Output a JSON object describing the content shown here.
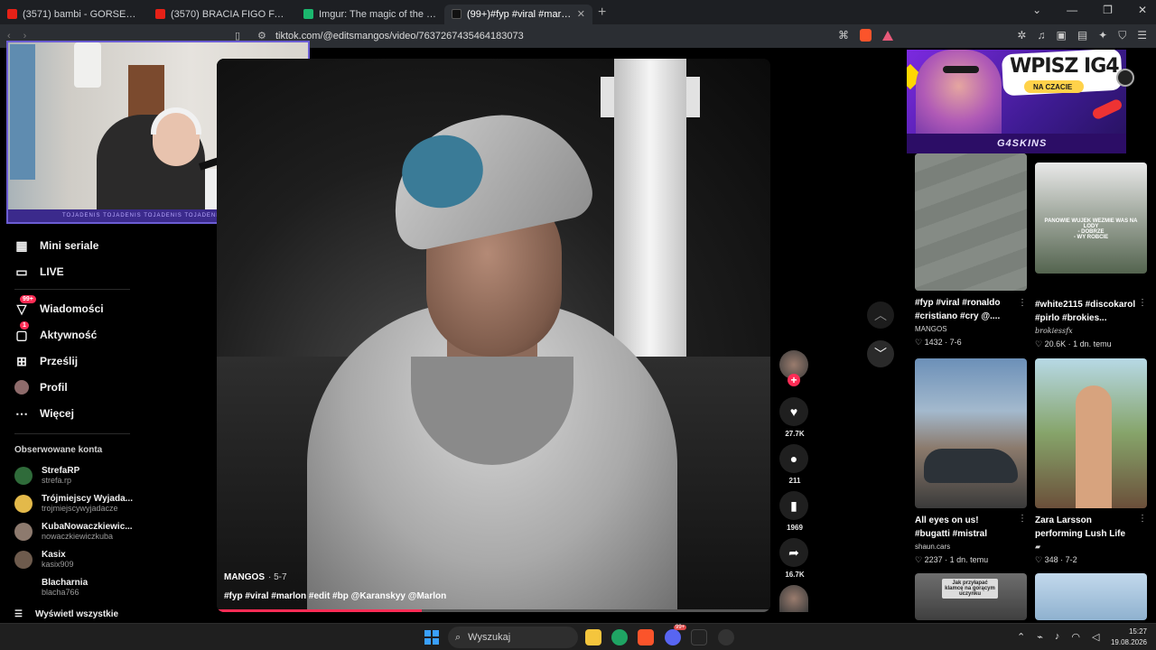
{
  "browser": {
    "tabs": [
      {
        "title": "(3571) bambi - GORSET - YouTube",
        "icon": "youtube-icon"
      },
      {
        "title": "(3570) BRACIA FIGO FAGOT - CZY KO",
        "icon": "youtube-icon"
      },
      {
        "title": "Imgur: The magic of the Internet",
        "icon": "imgur-icon"
      },
      {
        "title": "(99+)#fyp #viral #marlon #edit #",
        "icon": "tiktok-icon"
      }
    ],
    "url": "tiktok.com/@editsmangos/video/7637267435464183073"
  },
  "webcam": {
    "strip_text": "TOJADENIS TOJADENIS TOJADENIS TOJADENIS TOJADENIS TOJADENIS TOJADENIS"
  },
  "sidebar": {
    "nav": [
      {
        "label": "Mini seriale",
        "icon": "mini-series-icon"
      },
      {
        "label": "LIVE",
        "icon": "live-icon"
      },
      {
        "label": "Wiadomości",
        "icon": "messages-icon",
        "badge": "99+"
      },
      {
        "label": "Aktywność",
        "icon": "activity-icon",
        "badge": "1"
      },
      {
        "label": "Prześlij",
        "icon": "upload-icon"
      },
      {
        "label": "Profil",
        "icon": "profile-icon"
      },
      {
        "label": "Więcej",
        "icon": "more-icon"
      }
    ],
    "following_title": "Obserwowane konta",
    "following": [
      {
        "name": "StrefaRP",
        "handle": "strefa.rp"
      },
      {
        "name": "Trójmiejscy Wyjada...",
        "handle": "trojmiejscywyjadacze"
      },
      {
        "name": "KubaNowaczkiewic...",
        "handle": "nowaczkiewiczkuba"
      },
      {
        "name": "Kasix",
        "handle": "kasix909"
      },
      {
        "name": "Blacharnia",
        "handle": "blacha766"
      }
    ],
    "see_all": "Wyświetl wszystkie"
  },
  "video": {
    "author": "MANGOS",
    "date": "· 5-7",
    "caption": "#fyp #viral #marlon #edit #bp @Karanskyy @Marlon",
    "progress": 0.37
  },
  "actions": {
    "likes": "27.7K",
    "comments": "211",
    "saves": "1969",
    "shares": "16.7K"
  },
  "ad": {
    "title": "WPISZ IG4",
    "subtitle": "NA CZACIE",
    "brand": "G4SKINS"
  },
  "cards": [
    {
      "title": "#fyp #viral #ronaldo #cristiano #cry @....",
      "author": "MANGOS",
      "stats": "♡ 1432 · 7-6"
    },
    {
      "title": "#white2115 #discokarol #pirlo #brokies...",
      "author": "brokiessfx",
      "stats": "♡ 20.6K · 1 dn. temu",
      "thumb_text": "PANOWIE WUJEK WEZMIE WAS NA LODY\n- DOBRZE\n- WY ROBCIE"
    },
    {
      "title": "All eyes on us! #bugatti #mistral #monaco...",
      "author": "shaun.cars",
      "stats": "♡ 2237 · 1 dn. temu"
    },
    {
      "title": "Zara Larsson performing Lush Life a...",
      "author": "",
      "stats": "♡ 348 · 7-2"
    },
    {
      "thumb_text": "Jak przyłapać klamcę na gorącym uczynku"
    }
  ],
  "taskbar": {
    "search_placeholder": "Wyszukaj",
    "time": "15:27",
    "date": "19.08.2026",
    "notification_badge": "99+"
  }
}
